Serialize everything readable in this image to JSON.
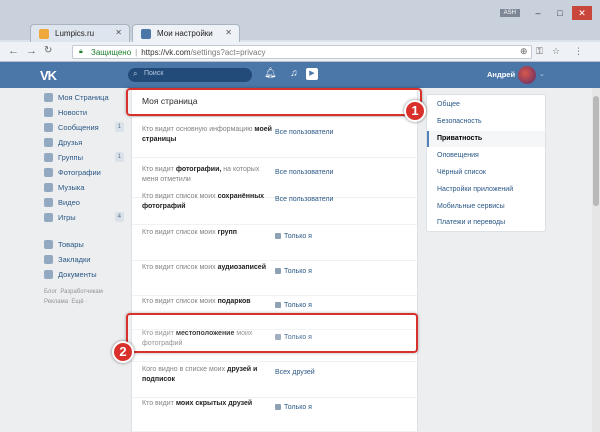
{
  "browser": {
    "tabs": [
      {
        "label": "Lumpics.ru",
        "favicon_color": "#f0a83a"
      },
      {
        "label": "Мои настройки",
        "favicon_color": "#4a76a8"
      }
    ],
    "user_chip": "ASH",
    "address": {
      "secure_label": "Защищено",
      "url_host": "https://vk.com",
      "url_path": "/settings?act=privacy"
    }
  },
  "vk_header": {
    "logo": "VK",
    "search_placeholder": "Поиск",
    "user_name": "Андрей"
  },
  "sidebar": {
    "items": [
      {
        "label": "Моя Страница",
        "count": ""
      },
      {
        "label": "Новости",
        "count": ""
      },
      {
        "label": "Сообщения",
        "count": "1"
      },
      {
        "label": "Друзья",
        "count": ""
      },
      {
        "label": "Группы",
        "count": "1"
      },
      {
        "label": "Фотографии",
        "count": ""
      },
      {
        "label": "Музыка",
        "count": ""
      },
      {
        "label": "Видео",
        "count": ""
      },
      {
        "label": "Игры",
        "count": "4"
      }
    ],
    "items2": [
      {
        "label": "Товары"
      },
      {
        "label": "Закладки"
      },
      {
        "label": "Документы"
      }
    ],
    "footer": [
      "Блог",
      "Разработчикам",
      "Реклама",
      "Ещё ·"
    ]
  },
  "main": {
    "section_title": "Моя страница",
    "rows": [
      {
        "q_plain": "Кто видит основную информацию ",
        "q_bold": "моей страницы",
        "value": "Все пользователи",
        "locked": false
      },
      {
        "q_plain": "Кто видит ",
        "q_bold": "фотографии,",
        "q_plain2": " на которых меня отметили",
        "value": "Все пользователи",
        "locked": false
      },
      {
        "q_plain": "Кто видит список моих ",
        "q_bold": "сохранённых фотографий",
        "value": "Все пользователи",
        "locked": false
      },
      {
        "q_plain": "Кто видит список моих ",
        "q_bold": "групп",
        "value": "Только я",
        "locked": true
      },
      {
        "q_plain": "Кто видит список моих ",
        "q_bold": "аудиозаписей",
        "value": "Только я",
        "locked": true
      },
      {
        "q_plain": "Кто видит список моих ",
        "q_bold": "подарков",
        "value": "Только я",
        "locked": true
      },
      {
        "q_plain": "Кто видит ",
        "q_bold": "местоположение",
        "q_plain2": " моих фотографий",
        "value": "Только я",
        "locked": true
      },
      {
        "q_plain": "Кого видно в списке моих ",
        "q_bold": "друзей и подписок",
        "value": "Всех друзей",
        "locked": false
      },
      {
        "q_plain": "Кто видит ",
        "q_bold": "моих скрытых друзей",
        "value": "Только я",
        "locked": true
      }
    ]
  },
  "settings_menu": {
    "items": [
      {
        "label": "Общее"
      },
      {
        "label": "Безопасность"
      },
      {
        "label": "Приватность",
        "active": true
      },
      {
        "label": "Оповещения"
      },
      {
        "label": "Чёрный список"
      },
      {
        "label": "Настройки приложений"
      },
      {
        "label": "Мобильные сервисы"
      },
      {
        "label": "Платежи и переводы"
      }
    ]
  },
  "annotations": {
    "badge1": "1",
    "badge2": "2"
  },
  "colors": {
    "vk_blue": "#4a76a8",
    "highlight_red": "#d8302a"
  }
}
